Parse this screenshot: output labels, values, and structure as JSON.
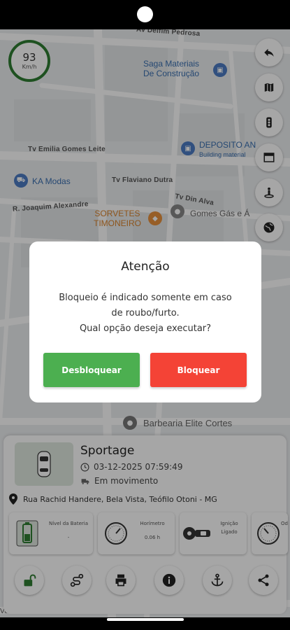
{
  "speed": {
    "value": "93",
    "unit": "Km/h"
  },
  "map": {
    "streets": [
      "Av Delfim Pedrosa",
      "Tv Emilia Gomes Leite",
      "Tv Flaviano Dutra",
      "R. Joaquim Alexandre",
      "Tv Din Alva"
    ],
    "pois": [
      {
        "name": "Saga Materiais",
        "sub": "De Construção"
      },
      {
        "name": "DEPOSITO AN",
        "sub": "Building material"
      },
      {
        "name": "KA Modas"
      },
      {
        "name": "SORVETES",
        "sub": "TIMONEIRO"
      },
      {
        "name": "Gomes Gás e Á"
      },
      {
        "name": "Barbearia Elite Cortes"
      }
    ],
    "buttons": [
      "back-icon",
      "map-icon",
      "traffic-light-icon",
      "satellite-icon",
      "street-view-icon",
      "globe-icon"
    ]
  },
  "dialog": {
    "title": "Atenção",
    "message_line1": "Bloqueio é indicado somente em caso",
    "message_line2": "de roubo/furto.",
    "message_line3": "Qual opção deseja executar?",
    "unlock_label": "Desbloquear",
    "lock_label": "Bloquear",
    "unlock_color": "#4caf50",
    "lock_color": "#f44336"
  },
  "vehicle": {
    "name": "Sportage",
    "datetime": "03-12-2025 07:59:49",
    "status": "Em movimento",
    "address": "Rua Rachid Handere, Bela Vista, Teófilo Otoni - MG"
  },
  "metrics": [
    {
      "label": "Nível da Bateria",
      "value": "-"
    },
    {
      "label": "Horímetro",
      "value": "0.06 h"
    },
    {
      "label": "Ignição",
      "value": "Ligado"
    },
    {
      "label": "Od",
      "value": ""
    }
  ],
  "actions": [
    "unlock-icon",
    "route-icon",
    "print-icon",
    "info-icon",
    "anchor-icon",
    "share-icon"
  ],
  "street_bottom": "Vereiro Santofio"
}
